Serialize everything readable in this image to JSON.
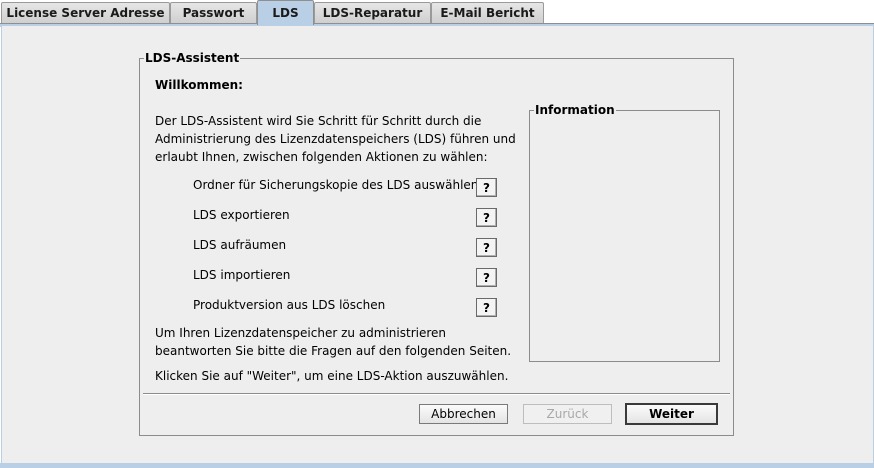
{
  "tabs": [
    {
      "label": "License Server Adresse",
      "active": false
    },
    {
      "label": "Passwort",
      "active": false
    },
    {
      "label": "LDS",
      "active": true
    },
    {
      "label": "LDS-Reparatur",
      "active": false
    },
    {
      "label": "E-Mail Bericht",
      "active": false
    }
  ],
  "wizard": {
    "group_title": "LDS-Assistent",
    "welcome": "Willkommen:",
    "intro": "Der LDS-Assistent wird Sie Schritt für Schritt durch die Administrierung des Lizenzdatenspeichers (LDS) führen und erlaubt Ihnen, zwischen folgenden Aktionen zu wählen:",
    "actions": [
      {
        "label": "Ordner für Sicherungskopie des LDS auswählen",
        "help": "?"
      },
      {
        "label": "LDS exportieren",
        "help": "?"
      },
      {
        "label": "LDS aufräumen",
        "help": "?"
      },
      {
        "label": "LDS importieren",
        "help": "?"
      },
      {
        "label": "Produktversion aus LDS löschen",
        "help": "?"
      }
    ],
    "outro": "Um Ihren Lizenzdatenspeicher zu administrieren beantworten Sie bitte die Fragen auf den folgenden Seiten.",
    "outro2": "Klicken Sie auf \"Weiter\", um eine LDS-Aktion auszuwählen.",
    "info_title": "Information"
  },
  "buttons": {
    "cancel": "Abbrechen",
    "back": "Zurück",
    "next": "Weiter"
  },
  "colors": {
    "accent": "#b8cfe5",
    "panel_bg": "#eeeeee"
  }
}
